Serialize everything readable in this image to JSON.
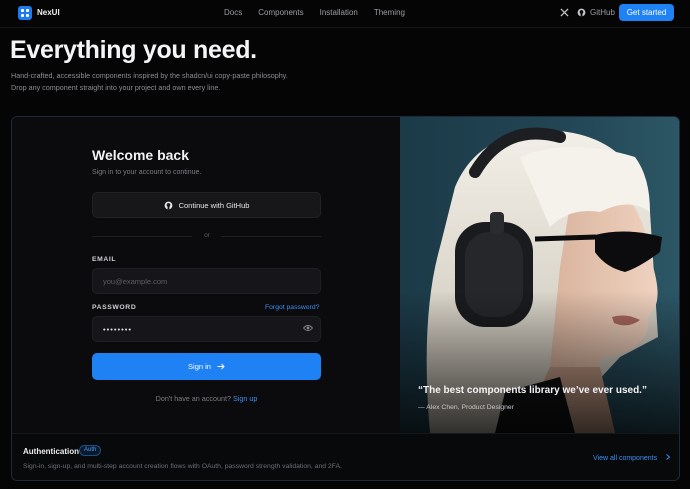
{
  "brand": {
    "name": "NexUI"
  },
  "nav": {
    "links": [
      "Docs",
      "Components",
      "Installation",
      "Theming"
    ],
    "github_label": "GitHub",
    "cta_label": "Get started"
  },
  "hero": {
    "title": "Everything you need.",
    "subtitle_line1": "Hand-crafted, accessible components inspired by the shadcn/ui copy-paste philosophy.",
    "subtitle_line2": "Drop any component straight into your project and own every line."
  },
  "login": {
    "title": "Welcome back",
    "subtitle": "Sign in to your account to continue.",
    "github_button": "Continue with GitHub",
    "divider": "or",
    "email_label": "EMAIL",
    "email_placeholder": "you@example.com",
    "password_label": "PASSWORD",
    "forgot_label": "Forgot password?",
    "password_value": "••••••••",
    "signin_label": "Sign in",
    "no_account": "Don't have an account?",
    "signup_label": "Sign up"
  },
  "testimonial": {
    "quote": "“The best components library we’ve ever used.”",
    "author": "— Alex Chen, Product Designer"
  },
  "footer": {
    "title": "Authentication",
    "badge": "Auth",
    "description": "Sign-in, sign-up, and multi-step account creation flows with OAuth, password strength validation, and 2FA.",
    "view_all": "View all components"
  },
  "colors": {
    "accent": "#1f82f4",
    "link": "#3d8ff6",
    "background": "#050506"
  },
  "icons": [
    "x-logo-icon",
    "github-icon",
    "eye-icon",
    "arrow-right-icon",
    "chevron-right-icon"
  ]
}
